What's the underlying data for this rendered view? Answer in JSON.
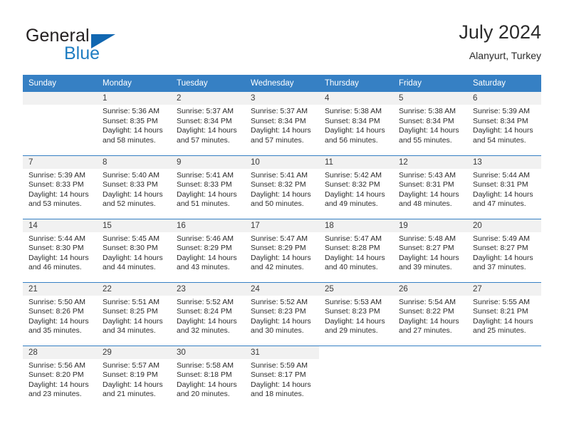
{
  "brand": {
    "name_part1": "General",
    "name_part2": "Blue",
    "colors": {
      "dark": "#231f20",
      "blue": "#1f7dc2",
      "triangle": "#1167b1"
    }
  },
  "header": {
    "title": "July 2024",
    "location": "Alanyurt, Turkey"
  },
  "theme": {
    "header_blue": "#3680c4",
    "daynum_band": "#f1f1f1",
    "text": "#2b2b2b"
  },
  "weekdays": [
    "Sunday",
    "Monday",
    "Tuesday",
    "Wednesday",
    "Thursday",
    "Friday",
    "Saturday"
  ],
  "weeks": [
    [
      {
        "day": ""
      },
      {
        "day": "1",
        "sunrise": "Sunrise: 5:36 AM",
        "sunset": "Sunset: 8:35 PM",
        "daylight1": "Daylight: 14 hours",
        "daylight2": "and 58 minutes."
      },
      {
        "day": "2",
        "sunrise": "Sunrise: 5:37 AM",
        "sunset": "Sunset: 8:34 PM",
        "daylight1": "Daylight: 14 hours",
        "daylight2": "and 57 minutes."
      },
      {
        "day": "3",
        "sunrise": "Sunrise: 5:37 AM",
        "sunset": "Sunset: 8:34 PM",
        "daylight1": "Daylight: 14 hours",
        "daylight2": "and 57 minutes."
      },
      {
        "day": "4",
        "sunrise": "Sunrise: 5:38 AM",
        "sunset": "Sunset: 8:34 PM",
        "daylight1": "Daylight: 14 hours",
        "daylight2": "and 56 minutes."
      },
      {
        "day": "5",
        "sunrise": "Sunrise: 5:38 AM",
        "sunset": "Sunset: 8:34 PM",
        "daylight1": "Daylight: 14 hours",
        "daylight2": "and 55 minutes."
      },
      {
        "day": "6",
        "sunrise": "Sunrise: 5:39 AM",
        "sunset": "Sunset: 8:34 PM",
        "daylight1": "Daylight: 14 hours",
        "daylight2": "and 54 minutes."
      }
    ],
    [
      {
        "day": "7",
        "sunrise": "Sunrise: 5:39 AM",
        "sunset": "Sunset: 8:33 PM",
        "daylight1": "Daylight: 14 hours",
        "daylight2": "and 53 minutes."
      },
      {
        "day": "8",
        "sunrise": "Sunrise: 5:40 AM",
        "sunset": "Sunset: 8:33 PM",
        "daylight1": "Daylight: 14 hours",
        "daylight2": "and 52 minutes."
      },
      {
        "day": "9",
        "sunrise": "Sunrise: 5:41 AM",
        "sunset": "Sunset: 8:33 PM",
        "daylight1": "Daylight: 14 hours",
        "daylight2": "and 51 minutes."
      },
      {
        "day": "10",
        "sunrise": "Sunrise: 5:41 AM",
        "sunset": "Sunset: 8:32 PM",
        "daylight1": "Daylight: 14 hours",
        "daylight2": "and 50 minutes."
      },
      {
        "day": "11",
        "sunrise": "Sunrise: 5:42 AM",
        "sunset": "Sunset: 8:32 PM",
        "daylight1": "Daylight: 14 hours",
        "daylight2": "and 49 minutes."
      },
      {
        "day": "12",
        "sunrise": "Sunrise: 5:43 AM",
        "sunset": "Sunset: 8:31 PM",
        "daylight1": "Daylight: 14 hours",
        "daylight2": "and 48 minutes."
      },
      {
        "day": "13",
        "sunrise": "Sunrise: 5:44 AM",
        "sunset": "Sunset: 8:31 PM",
        "daylight1": "Daylight: 14 hours",
        "daylight2": "and 47 minutes."
      }
    ],
    [
      {
        "day": "14",
        "sunrise": "Sunrise: 5:44 AM",
        "sunset": "Sunset: 8:30 PM",
        "daylight1": "Daylight: 14 hours",
        "daylight2": "and 46 minutes."
      },
      {
        "day": "15",
        "sunrise": "Sunrise: 5:45 AM",
        "sunset": "Sunset: 8:30 PM",
        "daylight1": "Daylight: 14 hours",
        "daylight2": "and 44 minutes."
      },
      {
        "day": "16",
        "sunrise": "Sunrise: 5:46 AM",
        "sunset": "Sunset: 8:29 PM",
        "daylight1": "Daylight: 14 hours",
        "daylight2": "and 43 minutes."
      },
      {
        "day": "17",
        "sunrise": "Sunrise: 5:47 AM",
        "sunset": "Sunset: 8:29 PM",
        "daylight1": "Daylight: 14 hours",
        "daylight2": "and 42 minutes."
      },
      {
        "day": "18",
        "sunrise": "Sunrise: 5:47 AM",
        "sunset": "Sunset: 8:28 PM",
        "daylight1": "Daylight: 14 hours",
        "daylight2": "and 40 minutes."
      },
      {
        "day": "19",
        "sunrise": "Sunrise: 5:48 AM",
        "sunset": "Sunset: 8:27 PM",
        "daylight1": "Daylight: 14 hours",
        "daylight2": "and 39 minutes."
      },
      {
        "day": "20",
        "sunrise": "Sunrise: 5:49 AM",
        "sunset": "Sunset: 8:27 PM",
        "daylight1": "Daylight: 14 hours",
        "daylight2": "and 37 minutes."
      }
    ],
    [
      {
        "day": "21",
        "sunrise": "Sunrise: 5:50 AM",
        "sunset": "Sunset: 8:26 PM",
        "daylight1": "Daylight: 14 hours",
        "daylight2": "and 35 minutes."
      },
      {
        "day": "22",
        "sunrise": "Sunrise: 5:51 AM",
        "sunset": "Sunset: 8:25 PM",
        "daylight1": "Daylight: 14 hours",
        "daylight2": "and 34 minutes."
      },
      {
        "day": "23",
        "sunrise": "Sunrise: 5:52 AM",
        "sunset": "Sunset: 8:24 PM",
        "daylight1": "Daylight: 14 hours",
        "daylight2": "and 32 minutes."
      },
      {
        "day": "24",
        "sunrise": "Sunrise: 5:52 AM",
        "sunset": "Sunset: 8:23 PM",
        "daylight1": "Daylight: 14 hours",
        "daylight2": "and 30 minutes."
      },
      {
        "day": "25",
        "sunrise": "Sunrise: 5:53 AM",
        "sunset": "Sunset: 8:23 PM",
        "daylight1": "Daylight: 14 hours",
        "daylight2": "and 29 minutes."
      },
      {
        "day": "26",
        "sunrise": "Sunrise: 5:54 AM",
        "sunset": "Sunset: 8:22 PM",
        "daylight1": "Daylight: 14 hours",
        "daylight2": "and 27 minutes."
      },
      {
        "day": "27",
        "sunrise": "Sunrise: 5:55 AM",
        "sunset": "Sunset: 8:21 PM",
        "daylight1": "Daylight: 14 hours",
        "daylight2": "and 25 minutes."
      }
    ],
    [
      {
        "day": "28",
        "sunrise": "Sunrise: 5:56 AM",
        "sunset": "Sunset: 8:20 PM",
        "daylight1": "Daylight: 14 hours",
        "daylight2": "and 23 minutes."
      },
      {
        "day": "29",
        "sunrise": "Sunrise: 5:57 AM",
        "sunset": "Sunset: 8:19 PM",
        "daylight1": "Daylight: 14 hours",
        "daylight2": "and 21 minutes."
      },
      {
        "day": "30",
        "sunrise": "Sunrise: 5:58 AM",
        "sunset": "Sunset: 8:18 PM",
        "daylight1": "Daylight: 14 hours",
        "daylight2": "and 20 minutes."
      },
      {
        "day": "31",
        "sunrise": "Sunrise: 5:59 AM",
        "sunset": "Sunset: 8:17 PM",
        "daylight1": "Daylight: 14 hours",
        "daylight2": "and 18 minutes."
      },
      {
        "day": ""
      },
      {
        "day": ""
      },
      {
        "day": ""
      }
    ]
  ]
}
